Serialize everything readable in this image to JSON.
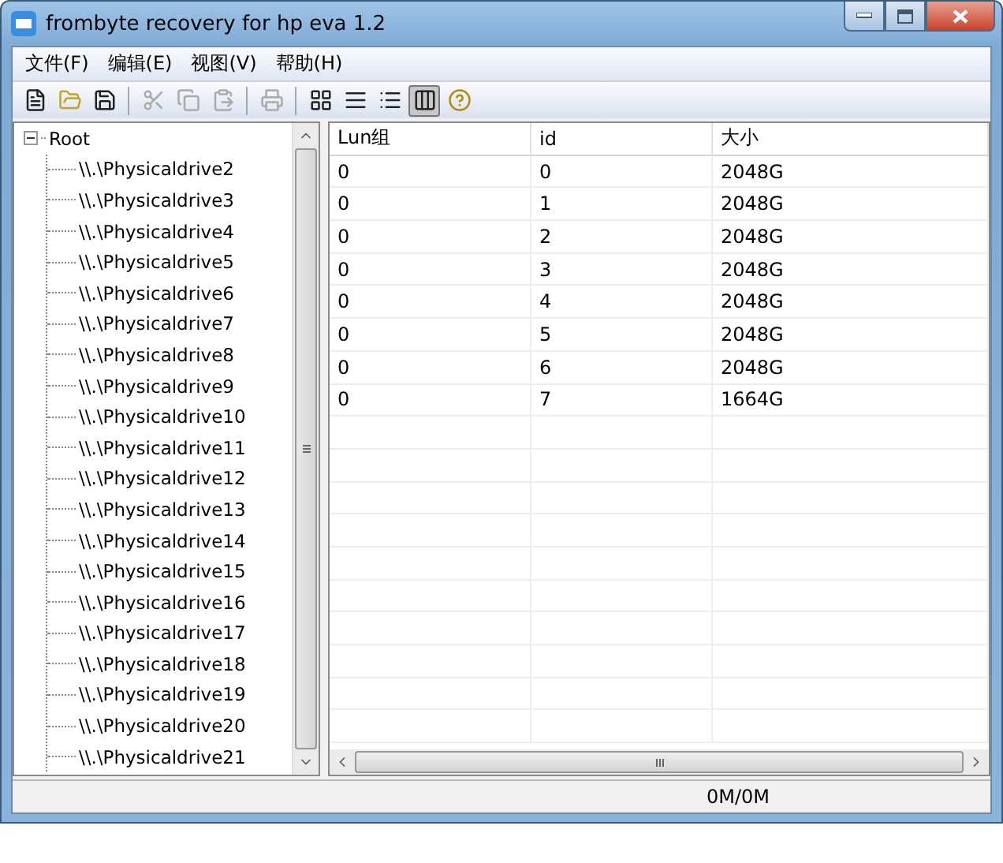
{
  "window": {
    "title": "frombyte recovery for hp eva 1.2"
  },
  "menu": [
    {
      "label": "文件(F)"
    },
    {
      "label": "编辑(E)"
    },
    {
      "label": "视图(V)"
    },
    {
      "label": "帮助(H)"
    }
  ],
  "toolbar": [
    {
      "kind": "new",
      "disabled": false
    },
    {
      "kind": "open",
      "disabled": false
    },
    {
      "kind": "save",
      "disabled": false
    },
    {
      "kind": "separator"
    },
    {
      "kind": "cut",
      "disabled": true
    },
    {
      "kind": "copy",
      "disabled": true
    },
    {
      "kind": "paste",
      "disabled": true
    },
    {
      "kind": "separator"
    },
    {
      "kind": "print",
      "disabled": true
    },
    {
      "kind": "separator"
    },
    {
      "kind": "large-icons",
      "selected": false
    },
    {
      "kind": "small-icons",
      "selected": false
    },
    {
      "kind": "list",
      "selected": false
    },
    {
      "kind": "details",
      "selected": true
    },
    {
      "kind": "help",
      "disabled": false
    }
  ],
  "tree": {
    "label": "Root",
    "expanded": true,
    "children": [
      {
        "label": "\\\\.\\Physicaldrive2"
      },
      {
        "label": "\\\\.\\Physicaldrive3"
      },
      {
        "label": "\\\\.\\Physicaldrive4"
      },
      {
        "label": "\\\\.\\Physicaldrive5"
      },
      {
        "label": "\\\\.\\Physicaldrive6"
      },
      {
        "label": "\\\\.\\Physicaldrive7"
      },
      {
        "label": "\\\\.\\Physicaldrive8"
      },
      {
        "label": "\\\\.\\Physicaldrive9"
      },
      {
        "label": "\\\\.\\Physicaldrive10"
      },
      {
        "label": "\\\\.\\Physicaldrive11"
      },
      {
        "label": "\\\\.\\Physicaldrive12"
      },
      {
        "label": "\\\\.\\Physicaldrive13"
      },
      {
        "label": "\\\\.\\Physicaldrive14"
      },
      {
        "label": "\\\\.\\Physicaldrive15"
      },
      {
        "label": "\\\\.\\Physicaldrive16"
      },
      {
        "label": "\\\\.\\Physicaldrive17"
      },
      {
        "label": "\\\\.\\Physicaldrive18"
      },
      {
        "label": "\\\\.\\Physicaldrive19"
      },
      {
        "label": "\\\\.\\Physicaldrive20"
      },
      {
        "label": "\\\\.\\Physicaldrive21"
      }
    ]
  },
  "table": {
    "columns": [
      "Lun组",
      "id",
      "大小"
    ],
    "rows": [
      [
        "0",
        "0",
        "2048G"
      ],
      [
        "0",
        "1",
        "2048G"
      ],
      [
        "0",
        "2",
        "2048G"
      ],
      [
        "0",
        "3",
        "2048G"
      ],
      [
        "0",
        "4",
        "2048G"
      ],
      [
        "0",
        "5",
        "2048G"
      ],
      [
        "0",
        "6",
        "2048G"
      ],
      [
        "0",
        "7",
        "1664G"
      ]
    ]
  },
  "status_bar": {
    "progress": "0M/0M"
  }
}
